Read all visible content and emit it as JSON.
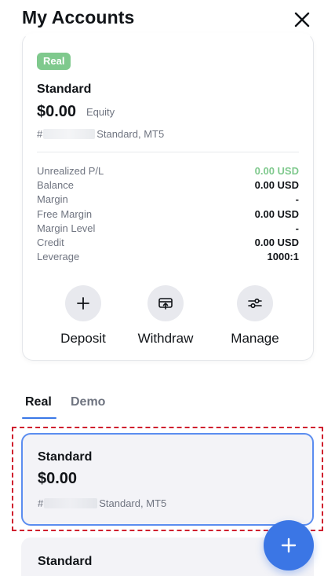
{
  "header": {
    "title": "My Accounts",
    "close_icon": "close-icon"
  },
  "account_card": {
    "badge": "Real",
    "name": "Standard",
    "balance": "$0.00",
    "balance_suffix": "Equity",
    "id_prefix": "#",
    "id_suffix": "Standard, MT5",
    "stats": [
      {
        "label": "Unrealized P/L",
        "value": "0.00 USD",
        "color": "#7fc98d"
      },
      {
        "label": "Balance",
        "value": "0.00 USD"
      },
      {
        "label": "Margin",
        "value": "-"
      },
      {
        "label": "Free Margin",
        "value": "0.00 USD"
      },
      {
        "label": "Margin Level",
        "value": "-"
      },
      {
        "label": "Credit",
        "value": "0.00 USD"
      },
      {
        "label": "Leverage",
        "value": "1000:1"
      }
    ],
    "actions": [
      {
        "label": "Deposit",
        "icon": "plus-icon"
      },
      {
        "label": "Withdraw",
        "icon": "withdraw-icon"
      },
      {
        "label": "Manage",
        "icon": "sliders-icon"
      }
    ]
  },
  "tabs": [
    {
      "label": "Real",
      "active": true
    },
    {
      "label": "Demo",
      "active": false
    }
  ],
  "accounts_list": [
    {
      "name": "Standard",
      "balance": "$0.00",
      "id_prefix": "#",
      "id_suffix": "Standard, MT5",
      "selected": true
    },
    {
      "name": "Standard"
    }
  ],
  "fab": {
    "icon": "plus-icon"
  },
  "colors": {
    "accent": "#3b76e5",
    "badge_green": "#7fc98d",
    "selection_dashed": "#d01f2e",
    "selected_border": "#5b8df0"
  }
}
